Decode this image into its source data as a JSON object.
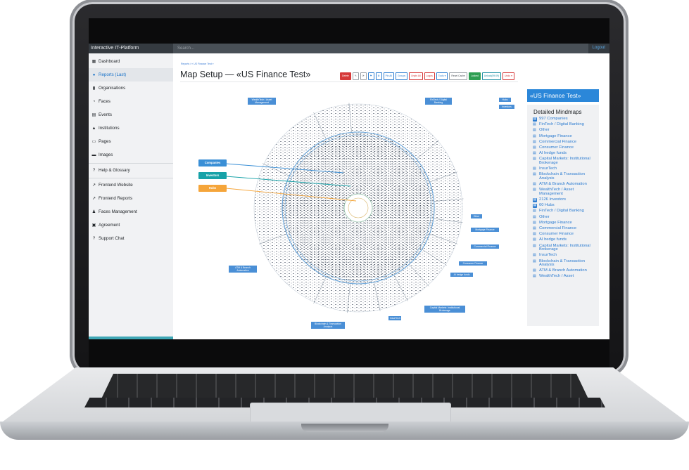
{
  "app": {
    "brand": "Interactive IT-Platform",
    "search_placeholder": "Search...",
    "logout": "Logout"
  },
  "sidebar": {
    "items": [
      {
        "label": "Dashboard",
        "icon": "dashboard-icon"
      },
      {
        "label": "Reports (Last)",
        "icon": "reports-icon"
      },
      {
        "label": "Organisations",
        "icon": "building-icon"
      },
      {
        "label": "Faces",
        "icon": "face-icon"
      },
      {
        "label": "Events",
        "icon": "calendar-icon"
      },
      {
        "label": "Institutions",
        "icon": "institution-icon"
      },
      {
        "label": "Pages",
        "icon": "page-icon"
      },
      {
        "label": "Images",
        "icon": "image-icon"
      },
      {
        "label": "Help & Glossary",
        "icon": "help-icon"
      },
      {
        "label": "Frontend Website",
        "icon": "external-link-icon"
      },
      {
        "label": "Frontend Reports",
        "icon": "external-link-icon"
      },
      {
        "label": "Faces Management",
        "icon": "users-icon"
      },
      {
        "label": "Agreement",
        "icon": "agreement-icon"
      },
      {
        "label": "Support Chat",
        "icon": "help-icon"
      }
    ]
  },
  "header": {
    "breadcrumb": "Reports  /  « US Finance Test »",
    "title": "Map Setup — «US Finance Test»"
  },
  "toolbar": {
    "delete": "Delete",
    "edit": "✎",
    "refresh": "⟳",
    "share": "⚑",
    "settings": "⚙",
    "pin_all": "Pin All",
    "groups": "Groups",
    "unpin_all": "Unpin All",
    "logos": "Logos",
    "tools": "Tools ▾",
    "reset_cache": "Reset Cache",
    "locked": "Locked",
    "unlock": "Unlock(59:09)",
    "undo": "Undo ▾"
  },
  "map": {
    "center_labels": {
      "companies": "Companies",
      "investors": "Investors",
      "hubs": "Hubs"
    },
    "segments": [
      "WealthTech / Asset Management",
      "FinTech / Digital Banking",
      "Hubs",
      "Investors",
      "Other",
      "Mortgage Finance",
      "Commercial Finance",
      "Consumer Finance",
      "AI hedge funds",
      "Capital Markets: Institutional Brokerage",
      "InsurTech",
      "Blockchain & Transaction Analysis",
      "ATM & Branch Automation"
    ],
    "colors": {
      "companies": "#3a8fd6",
      "investors": "#17a2a8",
      "hubs": "#f5a53a",
      "segment": "#4a8fd6"
    }
  },
  "panel": {
    "header": "«US Finance Test»",
    "title": "Detailed Mindmaps",
    "items": [
      {
        "label": "997 Companies",
        "bold": true
      },
      {
        "label": "FinTech / Digital Banking",
        "bold": false
      },
      {
        "label": "Other",
        "bold": false
      },
      {
        "label": "Mortgage Finance",
        "bold": false
      },
      {
        "label": "Commercial Finance",
        "bold": false
      },
      {
        "label": "Consumer Finance",
        "bold": false
      },
      {
        "label": "AI hedge funds",
        "bold": false
      },
      {
        "label": "Capital Markets: Institutional Brokerage",
        "bold": false
      },
      {
        "label": "InsurTech",
        "bold": false
      },
      {
        "label": "Blockchain & Transaction Analysis",
        "bold": false
      },
      {
        "label": "ATM & Branch Automation",
        "bold": false
      },
      {
        "label": "WealthTech / Asset Management",
        "bold": false
      },
      {
        "label": "2126 Investors",
        "bold": true
      },
      {
        "label": "60 Hubs",
        "bold": true
      },
      {
        "label": "FinTech / Digital Banking",
        "bold": false
      },
      {
        "label": "Other",
        "bold": false
      },
      {
        "label": "Mortgage Finance",
        "bold": false
      },
      {
        "label": "Commercial Finance",
        "bold": false
      },
      {
        "label": "Consumer Finance",
        "bold": false
      },
      {
        "label": "AI hedge funds",
        "bold": false
      },
      {
        "label": "Capital Markets: Institutional Brokerage",
        "bold": false
      },
      {
        "label": "InsurTech",
        "bold": false
      },
      {
        "label": "Blockchain & Transaction Analysis",
        "bold": false
      },
      {
        "label": "ATM & Branch Automation",
        "bold": false
      },
      {
        "label": "WealthTech / Asset",
        "bold": false
      }
    ]
  }
}
